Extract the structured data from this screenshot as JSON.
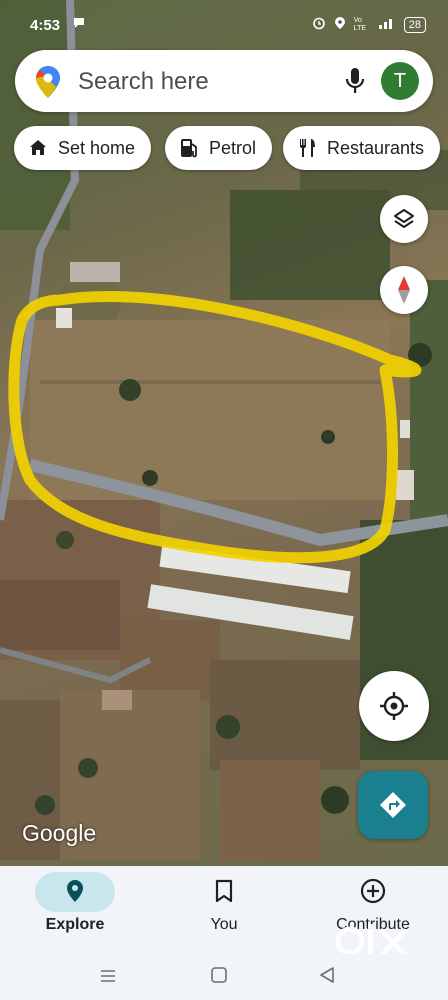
{
  "status_bar": {
    "time": "4:53",
    "network": "Vo LTE",
    "battery": "28"
  },
  "search": {
    "placeholder": "Search here",
    "avatar_letter": "T"
  },
  "chips": [
    {
      "label": "Set home",
      "icon": "home-icon"
    },
    {
      "label": "Petrol",
      "icon": "fuel-pump-icon"
    },
    {
      "label": "Restaurants",
      "icon": "fork-knife-icon"
    }
  ],
  "map": {
    "attribution": "Google",
    "annotation_color": "#f2d100"
  },
  "bottom_nav": {
    "items": [
      {
        "label": "Explore",
        "icon": "location-pin-icon",
        "active": true
      },
      {
        "label": "You",
        "icon": "bookmark-icon",
        "active": false
      },
      {
        "label": "Contribute",
        "icon": "plus-circle-icon",
        "active": false
      }
    ]
  },
  "watermark": {
    "text": "OLX"
  },
  "colors": {
    "accent": "#1a7f8e",
    "avatar": "#2e7d32",
    "nav_active_pill": "#c8e6ec"
  }
}
